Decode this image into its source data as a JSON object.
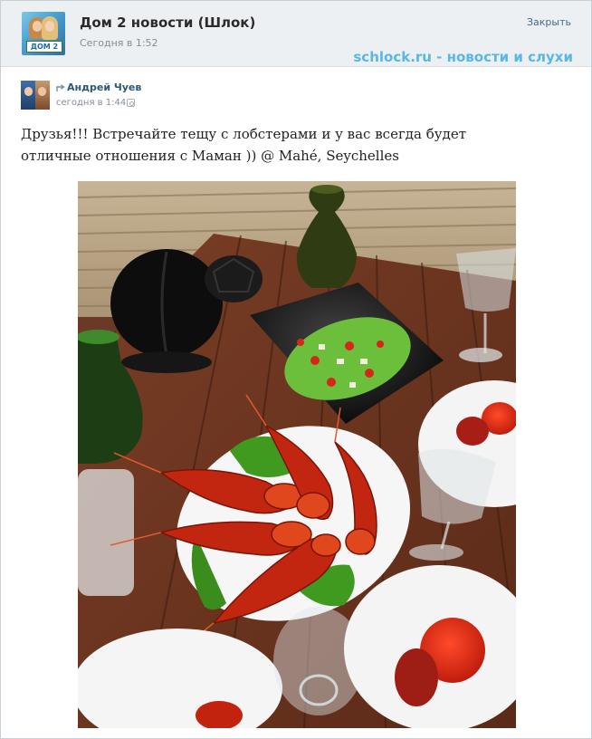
{
  "group": {
    "name": "Дом 2 новости (Шлок)",
    "time": "Сегодня в 1:52",
    "avatar_logo": "ДОМ 2"
  },
  "close_label": "Закрыть",
  "watermark": "schlock.ru - новости и слухи",
  "post": {
    "author": "Андрей Чуев",
    "time": "сегодня в 1:44",
    "text": "Друзья!!! Встречайте тещу с лобстерами и у вас всегда будет отличные отношения с Маман )) @ Mahé, Seychelles"
  },
  "icons": {
    "repost": "repost-arrow-icon",
    "instagram": "instagram-icon"
  },
  "colors": {
    "header_bg": "#edf0f3",
    "link": "#2b587a",
    "watermark": "#59b7e6"
  }
}
